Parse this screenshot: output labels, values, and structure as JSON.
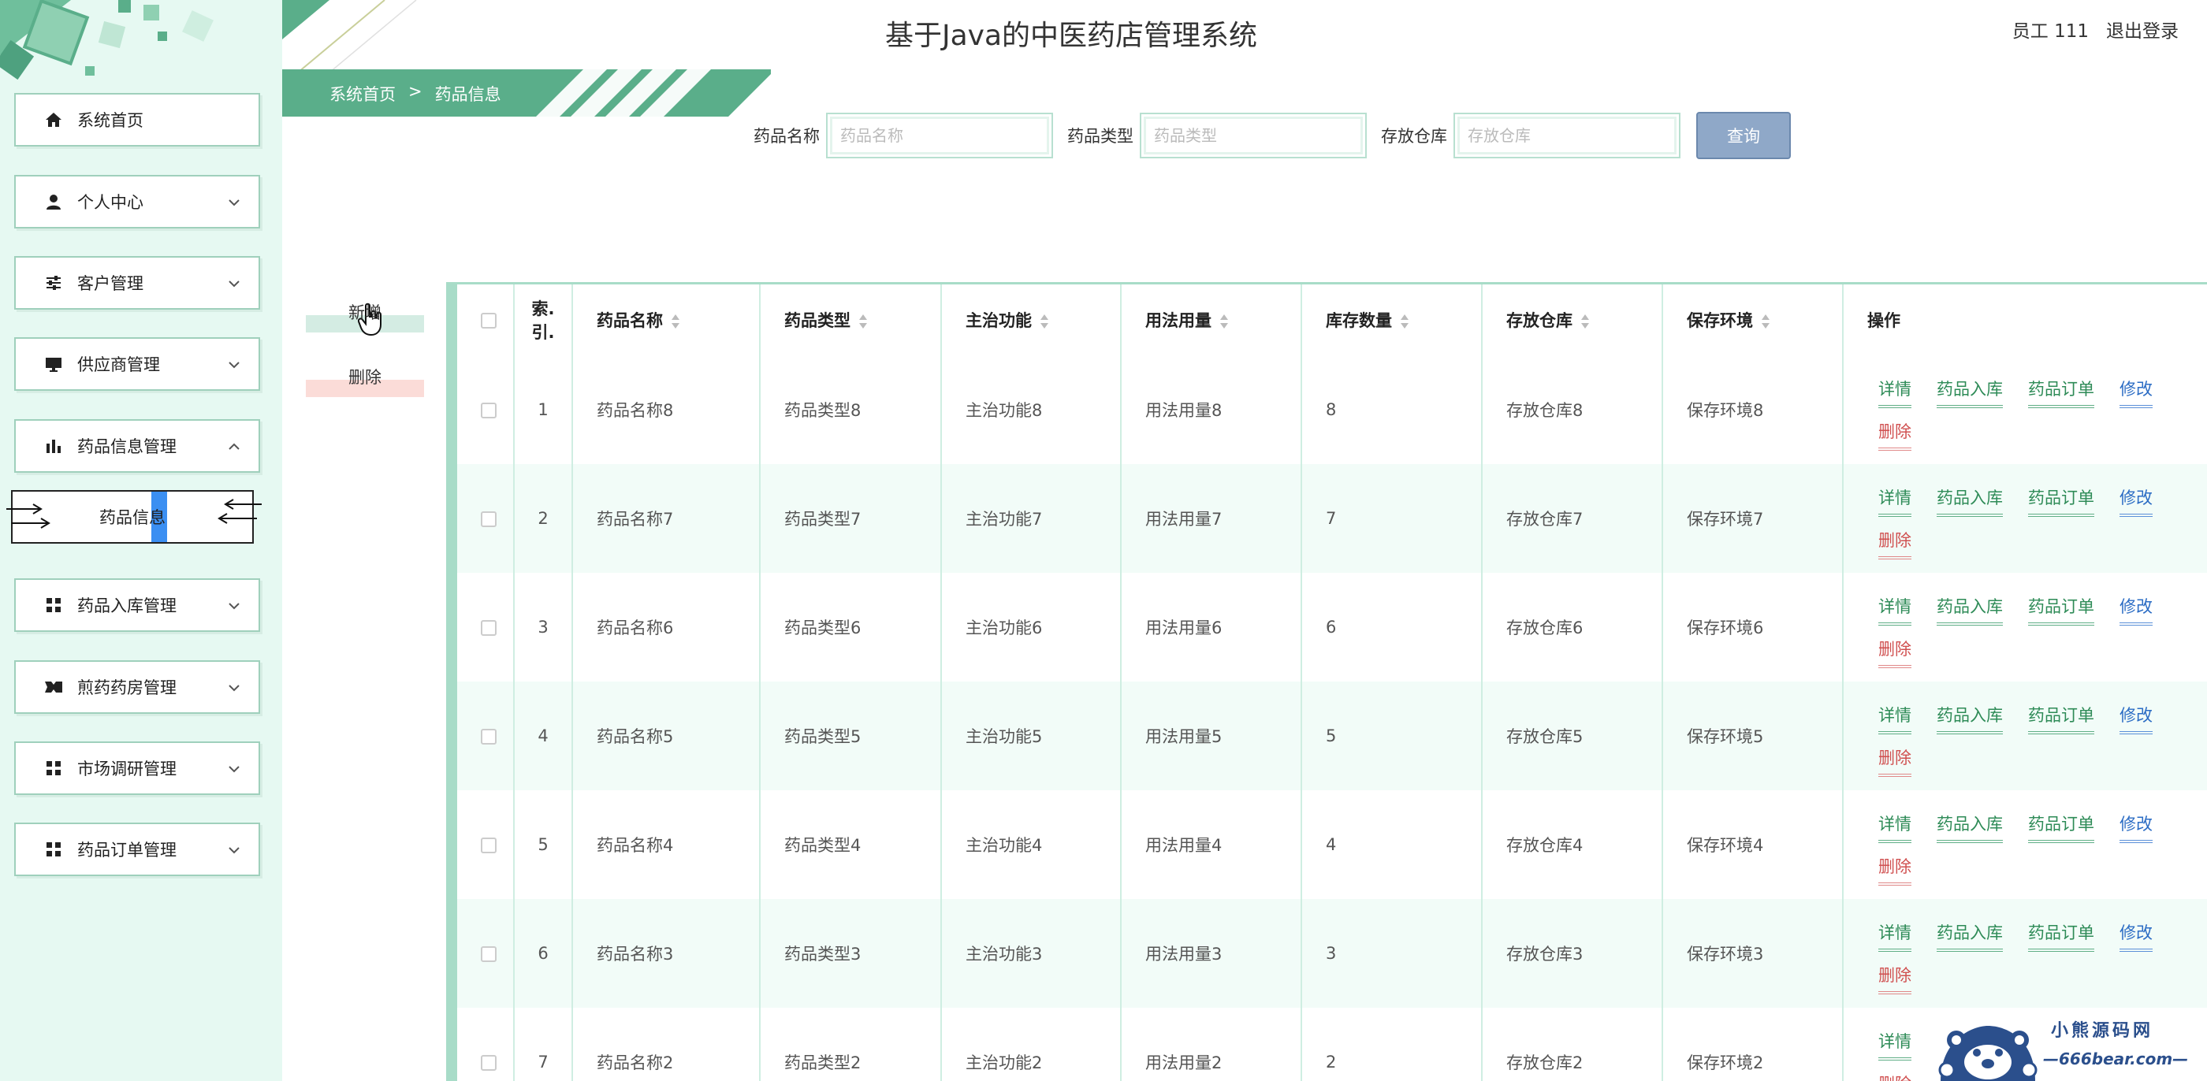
{
  "header": {
    "title": "基于Java的中医药店管理系统",
    "user": "员工 111",
    "logout": "退出登录"
  },
  "breadcrumb": {
    "home": "系统首页",
    "separator": ">",
    "current": "药品信息"
  },
  "sidebar": {
    "items": [
      {
        "label": "系统首页",
        "icon": "home-icon"
      },
      {
        "label": "个人中心",
        "icon": "user-icon"
      },
      {
        "label": "客户管理",
        "icon": "sliders-icon"
      },
      {
        "label": "供应商管理",
        "icon": "monitor-icon"
      },
      {
        "label": "药品信息管理",
        "icon": "bar-chart-icon"
      },
      {
        "label": "药品入库管理",
        "icon": "grid-icon"
      },
      {
        "label": "煎药药房管理",
        "icon": "ticket-icon"
      },
      {
        "label": "市场调研管理",
        "icon": "grid-icon"
      },
      {
        "label": "药品订单管理",
        "icon": "grid-icon"
      }
    ],
    "submenu": {
      "label": "药品信息"
    }
  },
  "search": {
    "name_label": "药品名称",
    "name_placeholder": "药品名称",
    "type_label": "药品类型",
    "type_placeholder": "药品类型",
    "warehouse_label": "存放仓库",
    "warehouse_placeholder": "存放仓库",
    "button": "查询"
  },
  "actions": {
    "add": "新增",
    "delete": "删除"
  },
  "table": {
    "columns": [
      "索引",
      "药品名称",
      "药品类型",
      "主治功能",
      "用法用量",
      "库存数量",
      "存放仓库",
      "保存环境",
      "操作"
    ],
    "index_header": {
      "line1": "索.",
      "line2": "引."
    },
    "operations": {
      "detail": "详情",
      "inbound": "药品入库",
      "order": "药品订单",
      "edit": "修改",
      "delete": "删除"
    },
    "rows": [
      {
        "index": "1",
        "name": "药品名称8",
        "type": "药品类型8",
        "function": "主治功能8",
        "usage": "用法用量8",
        "stock": "8",
        "warehouse": "存放仓库8",
        "storage": "保存环境8"
      },
      {
        "index": "2",
        "name": "药品名称7",
        "type": "药品类型7",
        "function": "主治功能7",
        "usage": "用法用量7",
        "stock": "7",
        "warehouse": "存放仓库7",
        "storage": "保存环境7"
      },
      {
        "index": "3",
        "name": "药品名称6",
        "type": "药品类型6",
        "function": "主治功能6",
        "usage": "用法用量6",
        "stock": "6",
        "warehouse": "存放仓库6",
        "storage": "保存环境6"
      },
      {
        "index": "4",
        "name": "药品名称5",
        "type": "药品类型5",
        "function": "主治功能5",
        "usage": "用法用量5",
        "stock": "5",
        "warehouse": "存放仓库5",
        "storage": "保存环境5"
      },
      {
        "index": "5",
        "name": "药品名称4",
        "type": "药品类型4",
        "function": "主治功能4",
        "usage": "用法用量4",
        "stock": "4",
        "warehouse": "存放仓库4",
        "storage": "保存环境4"
      },
      {
        "index": "6",
        "name": "药品名称3",
        "type": "药品类型3",
        "function": "主治功能3",
        "usage": "用法用量3",
        "stock": "3",
        "warehouse": "存放仓库3",
        "storage": "保存环境3"
      },
      {
        "index": "7",
        "name": "药品名称2",
        "type": "药品类型2",
        "function": "主治功能2",
        "usage": "用法用量2",
        "stock": "2",
        "warehouse": "存放仓库2",
        "storage": "保存环境2"
      }
    ]
  },
  "watermark": {
    "title": "小熊源码网",
    "url": "—666bear.com—"
  },
  "colors": {
    "brand_green": "#5aae8a",
    "sidebar_bg": "#e6f9f2",
    "query_button": "#8fa8c8",
    "link_green": "#2e8b57",
    "link_blue": "#2b6cc4",
    "link_red": "#d05050"
  }
}
